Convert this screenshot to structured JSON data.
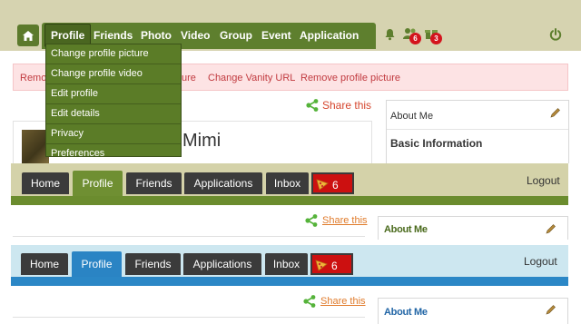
{
  "section1": {
    "nav": [
      "Profile",
      "Friends",
      "Photo",
      "Video",
      "Group",
      "Event",
      "Application"
    ],
    "badges": [
      "6",
      "3"
    ],
    "dropdown": [
      "Change profile picture",
      "Change profile video",
      "Edit profile",
      "Edit details",
      "Privacy",
      "Preferences"
    ],
    "pink_links": [
      "Remov",
      "ure",
      "Change Vanity URL",
      "Remove profile picture"
    ],
    "share": "Share this",
    "name_fragment": "i Mimi",
    "about_title": "About Me",
    "about_sub": "Basic Information"
  },
  "section2": {
    "tabs": [
      "Home",
      "Profile",
      "Friends",
      "Applications",
      "Inbox"
    ],
    "notif_count": "6",
    "logout": "Logout",
    "share": "Share this",
    "about_title": "About Me"
  },
  "section3": {
    "tabs": [
      "Home",
      "Profile",
      "Friends",
      "Applications",
      "Inbox"
    ],
    "notif_count": "6",
    "logout": "Logout",
    "share": "Share this",
    "about_title": "About Me"
  },
  "colors": {
    "green_nav": "#5e7f2e",
    "green_stripe": "#6b8c2e",
    "blue_stripe": "#2b87c6",
    "badge_red": "#d4141d"
  },
  "icons": [
    "home-icon",
    "bell-icon",
    "friends-icon",
    "gift-icon",
    "power-icon",
    "share-icon",
    "pencil-icon",
    "pizza-icon"
  ]
}
